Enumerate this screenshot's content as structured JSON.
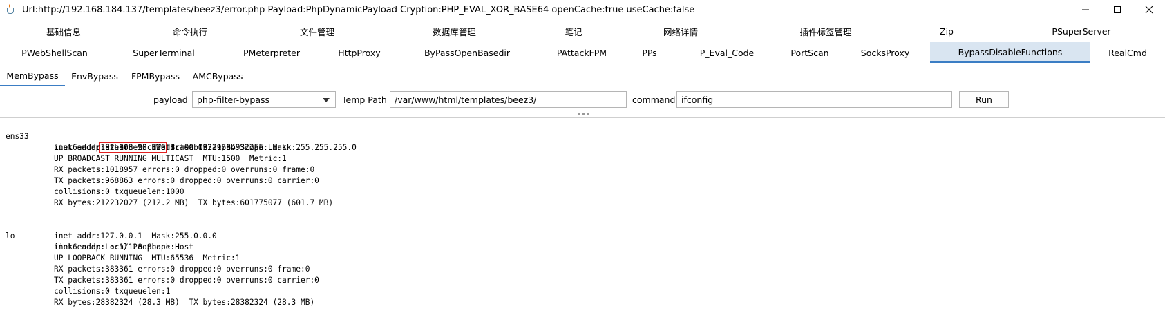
{
  "window": {
    "title": "Url:http://192.168.184.137/templates/beez3/error.php Payload:PhpDynamicPayload Cryption:PHP_EVAL_XOR_BASE64 openCache:true useCache:false",
    "minimize_glyph": "—",
    "maximize_glyph": "☐",
    "close_glyph": "✕"
  },
  "tabs_row1": [
    "基础信息",
    "命令执行",
    "文件管理",
    "数据库管理",
    "笔记",
    "网络详情",
    "插件标签管理",
    "Zip",
    "PSuperServer"
  ],
  "tabs_row2": [
    "PWebShellScan",
    "SuperTerminal",
    "PMeterpreter",
    "HttpProxy",
    "ByPassOpenBasedir",
    "PAttackFPM",
    "PPs",
    "P_Eval_Code",
    "PortScan",
    "SocksProxy",
    "BypassDisableFunctions",
    "RealCmd"
  ],
  "selected_tab": "BypassDisableFunctions",
  "subtabs": [
    "MemBypass",
    "EnvBypass",
    "FPMBypass",
    "AMCBypass"
  ],
  "selected_subtab": "MemBypass",
  "form": {
    "payload_label": "payload",
    "payload_value": "php-filter-bypass",
    "temp_path_label": "Temp Path",
    "temp_path_value": "/var/www/html/templates/beez3/",
    "command_label": "command",
    "command_value": "ifconfig",
    "run_label": "Run"
  },
  "output": {
    "ens33": {
      "name": "ens33",
      "link": "Link encap:Ethernet  HWaddr 00:0c:29:ab:32:ac",
      "inet_prefix": "inet addr:",
      "inet_ip": "192.168.93.120",
      "inet_suffix": " Bcast:192.168.93.255  Mask:255.255.255.0",
      "inet6": "inet6 addr: fe80::20c:29ff:feab:32ac/64 Scope:Link",
      "flags": "UP BROADCAST RUNNING MULTICAST  MTU:1500  Metric:1",
      "rx_packets": "RX packets:1018957 errors:0 dropped:0 overruns:0 frame:0",
      "tx_packets": "TX packets:968863 errors:0 dropped:0 overruns:0 carrier:0",
      "collisions": "collisions:0 txqueuelen:1000",
      "bytes": "RX bytes:212232027 (212.2 MB)  TX bytes:601775077 (601.7 MB)"
    },
    "lo": {
      "name": "lo",
      "link": "Link encap:Local Loopback",
      "inet": "inet addr:127.0.0.1  Mask:255.0.0.0",
      "inet6": "inet6 addr: ::1/128 Scope:Host",
      "flags": "UP LOOPBACK RUNNING  MTU:65536  Metric:1",
      "rx_packets": "RX packets:383361 errors:0 dropped:0 overruns:0 frame:0",
      "tx_packets": "TX packets:383361 errors:0 dropped:0 overruns:0 carrier:0",
      "collisions": "collisions:0 txqueuelen:1",
      "bytes": "RX bytes:28382324 (28.3 MB)  TX bytes:28382324 (28.3 MB)"
    }
  },
  "colors": {
    "selected_tab_bg": "#d9e5f1",
    "selected_underline": "#3b7dc4",
    "highlight_box": "#e02020"
  }
}
